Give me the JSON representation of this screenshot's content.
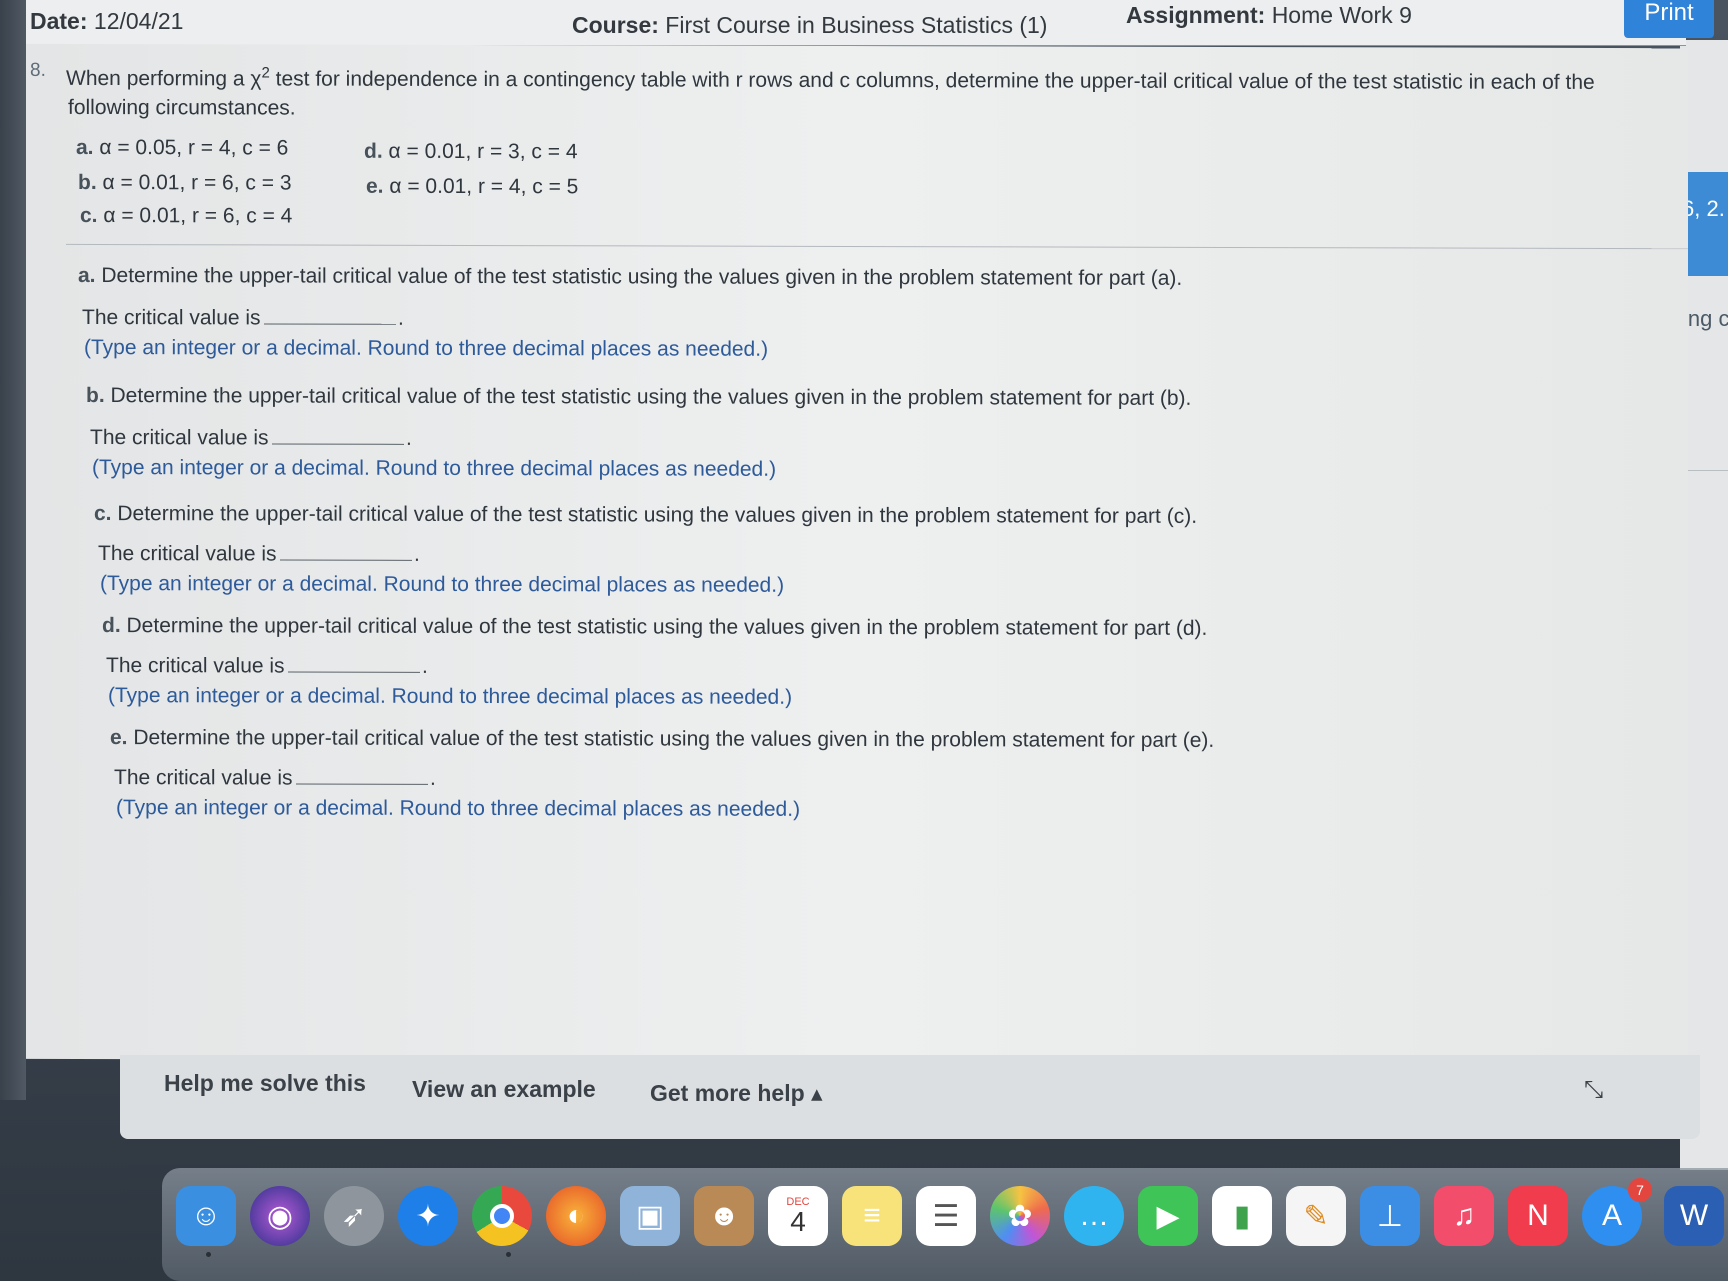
{
  "header": {
    "date_label": "Date:",
    "date_value": "12/04/21",
    "course_label": "Course:",
    "course_value": "First Course in Business Statistics (1)",
    "assignment_label": "Assignment:",
    "assignment_value": "Home Work 9",
    "print_label": "Print"
  },
  "question": {
    "number": "8.",
    "stem_part1": "When performing a χ",
    "stem_sup": "2",
    "stem_part2": " test for independence in a contingency table with r rows and c columns, determine the upper-tail critical value of the test statistic in each of the",
    "stem_line2": "following circumstances.",
    "cases": [
      {
        "letter": "a.",
        "text": "α = 0.05, r = 4, c = 6"
      },
      {
        "letter": "b.",
        "text": "α = 0.01, r = 6, c = 3"
      },
      {
        "letter": "c.",
        "text": "α = 0.01, r = 6, c = 4"
      },
      {
        "letter": "d.",
        "text": "α = 0.01, r = 3, c = 4"
      },
      {
        "letter": "e.",
        "text": "α = 0.01, r = 4, c = 5"
      }
    ]
  },
  "parts": [
    {
      "letter": "a.",
      "prompt": "Determine the upper-tail critical value of the test statistic using the values given in the problem statement for part (a).",
      "lead": "The critical value is",
      "value": "",
      "hint": "(Type an integer or a decimal. Round to three decimal places as needed.)"
    },
    {
      "letter": "b.",
      "prompt": "Determine the upper-tail critical value of the test statistic using the values given in the problem statement for part (b).",
      "lead": "The critical value is",
      "value": "",
      "hint": "(Type an integer or a decimal. Round to three decimal places as needed.)"
    },
    {
      "letter": "c.",
      "prompt": "Determine the upper-tail critical value of the test statistic using the values given in the problem statement for part (c).",
      "lead": "The critical value is",
      "value": "",
      "hint": "(Type an integer or a decimal. Round to three decimal places as needed.)"
    },
    {
      "letter": "d.",
      "prompt": "Determine the upper-tail critical value of the test statistic using the values given in the problem statement for part (d).",
      "lead": "The critical value is",
      "value": "",
      "hint": "(Type an integer or a decimal. Round to three decimal places as needed.)"
    },
    {
      "letter": "e.",
      "prompt": "Determine the upper-tail critical value of the test statistic using the values given in the problem statement for part (e).",
      "lead": "The critical value is",
      "value": "",
      "hint": "(Type an integer or a decimal. Round to three decimal places as needed.)"
    }
  ],
  "footer": {
    "help_solve": "Help me solve this",
    "view_example": "View an example",
    "more_help": "Get more help ▴"
  },
  "side_window": {
    "tab_text": "6, 2.",
    "text": "ving c"
  },
  "dock": {
    "calendar_month": "DEC",
    "calendar_day": "4",
    "appstore_badge": "7",
    "apps": [
      "finder-icon",
      "siri-icon",
      "launchpad-icon",
      "safari-icon",
      "chrome-icon",
      "firefox-icon",
      "preview-icon",
      "contacts-icon",
      "calendar-icon",
      "notes-icon",
      "reminders-icon",
      "photos-icon",
      "messages-icon",
      "facetime-icon",
      "numbers-icon",
      "pages-icon",
      "keynote-icon",
      "music-icon",
      "news-icon",
      "appstore-icon",
      "word-icon"
    ],
    "colors": {
      "finder": "#3b8fe0",
      "safari": "#1f7fe8",
      "chrome": "#e9483c",
      "firefox": "#f07a1c",
      "messages": "#2fb4f0",
      "facetime": "#3fc457",
      "music": "#f24e6c",
      "news": "#f03c4c",
      "appstore": "#2e8ff0"
    }
  }
}
